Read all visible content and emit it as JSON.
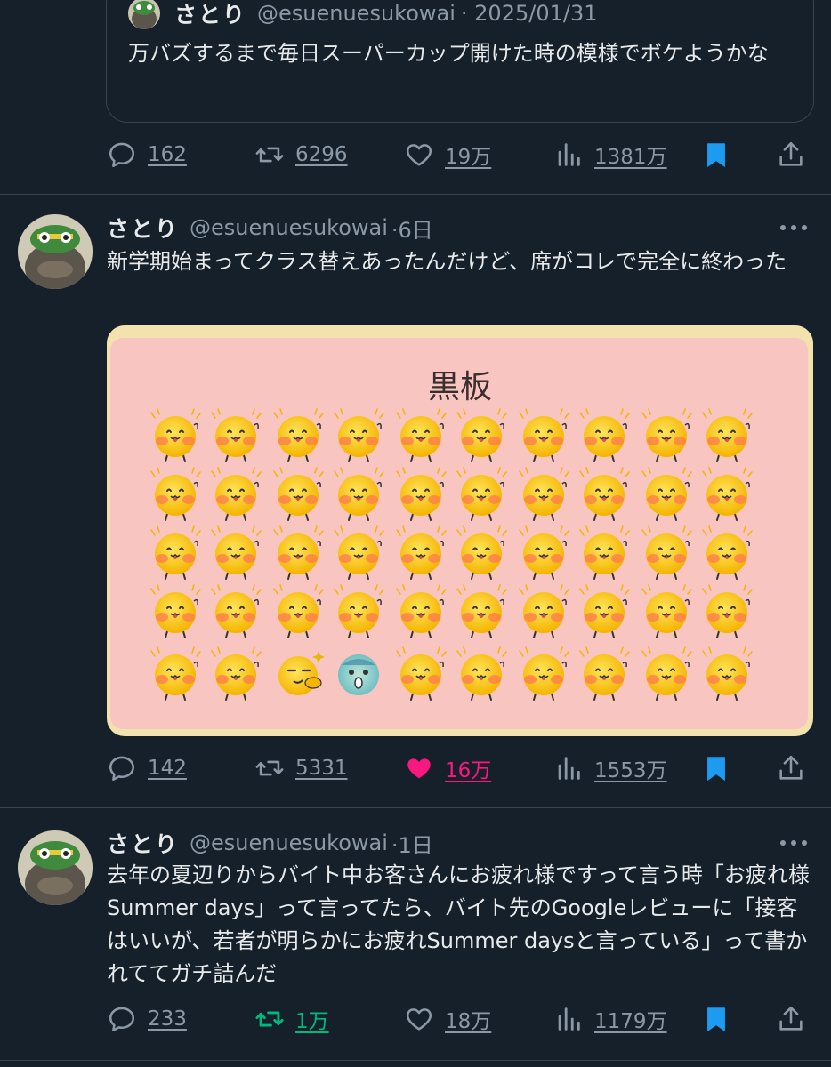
{
  "quoted": {
    "name": "さとり",
    "handle": "@esuenuesukowai",
    "date": "· 2025/01/31",
    "text": "万バズするまで毎日スーパーカップ開けた時の模様でボケようかな"
  },
  "top_actions": {
    "replies": "162",
    "retweets": "6296",
    "likes": "19万",
    "views": "1381万"
  },
  "tweet1": {
    "name": "さとり",
    "handle": "@esuenuesukowai",
    "time": "·6日",
    "text": "新学期始まってクラス替えあったんだけど、席がコレで完全に終わった",
    "image": {
      "board_label": "黒板"
    },
    "actions": {
      "replies": "142",
      "retweets": "5331",
      "likes": "16万",
      "views": "1553万"
    },
    "liked": true
  },
  "tweet2": {
    "name": "さとり",
    "handle": "@esuenuesukowai",
    "time": "·1日",
    "text": "去年の夏辺りからバイト中お客さんにお疲れ様ですって言う時「お疲れ様Summer days」って言ってたら、バイト先のGoogleレビューに「接客はいいが、若者が明らかにお疲れSummer daysと言っている」って書かれててガチ詰んだ",
    "actions": {
      "replies": "233",
      "retweets": "1万",
      "likes": "18万",
      "views": "1179万"
    },
    "retweeted": true
  },
  "colors": {
    "background": "#15202b",
    "text": "#e7e9ea",
    "muted": "#8b98a5",
    "border": "#38444d",
    "like": "#f91880",
    "retweet": "#00ba7c",
    "bookmark": "#1d9bf0"
  },
  "icons": [
    "reply-icon",
    "retweet-icon",
    "like-icon",
    "views-icon",
    "bookmark-icon",
    "share-icon",
    "more-icon"
  ]
}
